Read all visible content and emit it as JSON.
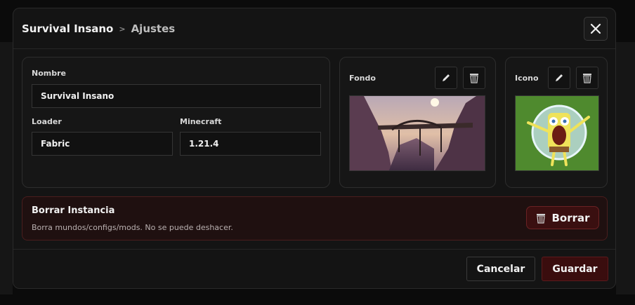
{
  "header": {
    "instance_name": "Survival Insano",
    "separator": ">",
    "section": "Ajustes"
  },
  "form": {
    "name_label": "Nombre",
    "name_value": "Survival Insano",
    "loader_label": "Loader",
    "loader_value": "Fabric",
    "minecraft_label": "Minecraft",
    "minecraft_value": "1.21.4"
  },
  "background": {
    "label": "Fondo"
  },
  "icon": {
    "label": "Icono"
  },
  "danger": {
    "title": "Borrar Instancia",
    "description": "Borra mundos/configs/mods. No se puede deshacer.",
    "button_label": "Borrar"
  },
  "footer": {
    "cancel_label": "Cancelar",
    "save_label": "Guardar"
  },
  "colors": {
    "accent_danger": "#3a0f10",
    "modal_bg": "#141414"
  }
}
